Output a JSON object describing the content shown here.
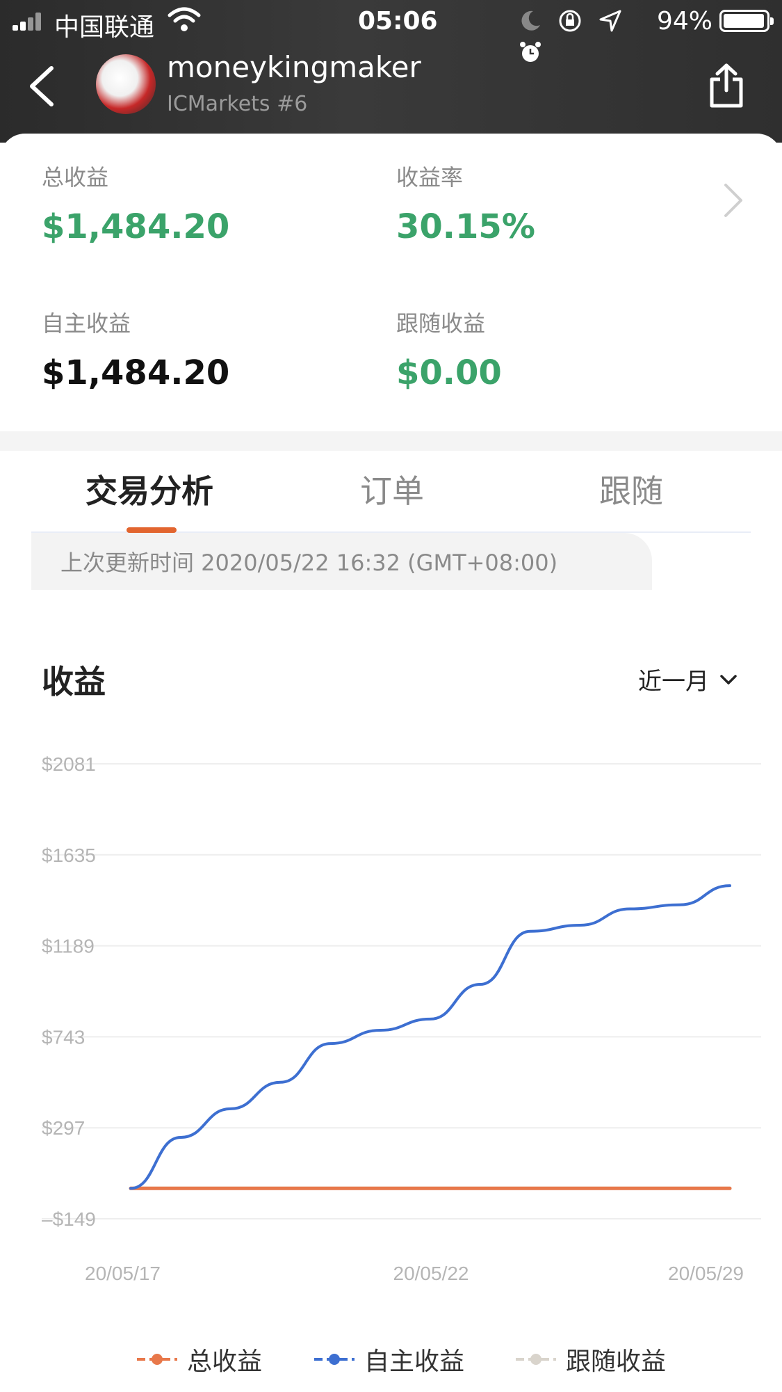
{
  "status_bar": {
    "carrier": "中国联通",
    "time": "05:06",
    "battery": "94%"
  },
  "header": {
    "username": "moneykingmaker",
    "account": "ICMarkets #6"
  },
  "stats": {
    "total_label": "总收益",
    "total_value": "$1,484.20",
    "rate_label": "收益率",
    "rate_value": "30.15%",
    "self_label": "自主收益",
    "self_value": "$1,484.20",
    "follow_label": "跟随收益",
    "follow_value": "$0.00"
  },
  "tabs": [
    {
      "label": "交易分析",
      "active": true
    },
    {
      "label": "订单",
      "active": false
    },
    {
      "label": "跟随",
      "active": false
    }
  ],
  "update_text": "上次更新时间 2020/05/22 16:32 (GMT+08:00)",
  "section": {
    "title": "收益",
    "range": "近一月"
  },
  "colors": {
    "total": "#e8784a",
    "self": "#3d6fd1",
    "follow": "#d9d4cc",
    "positive": "#3ba36a",
    "tab_accent": "#e2652f"
  },
  "chart_data": {
    "type": "line",
    "yticks": [
      "$2081",
      "$1635",
      "$1189",
      "$743",
      "$297",
      "–$149"
    ],
    "ytick_values": [
      2081,
      1635,
      1189,
      743,
      297,
      -149
    ],
    "ylim": [
      -149,
      2081
    ],
    "xticks": [
      "20/05/17",
      "20/05/22",
      "20/05/29"
    ],
    "x": [
      "20/05/17",
      "20/05/18",
      "20/05/19",
      "20/05/20",
      "20/05/21",
      "20/05/22",
      "20/05/23",
      "20/05/24",
      "20/05/25",
      "20/05/26",
      "20/05/27",
      "20/05/28",
      "20/05/29"
    ],
    "series": [
      {
        "name": "总收益",
        "color": "#e8784a",
        "values": [
          0,
          0,
          0,
          0,
          0,
          0,
          0,
          0,
          0,
          0,
          0,
          0,
          0
        ]
      },
      {
        "name": "自主收益",
        "color": "#3d6fd1",
        "values": [
          0,
          250,
          390,
          520,
          710,
          775,
          830,
          1000,
          1260,
          1290,
          1370,
          1390,
          1484
        ]
      },
      {
        "name": "跟随收益",
        "color": "#d9d4cc",
        "values": [
          0,
          0,
          0,
          0,
          0,
          0,
          0,
          0,
          0,
          0,
          0,
          0,
          0
        ]
      }
    ],
    "grid": true
  }
}
